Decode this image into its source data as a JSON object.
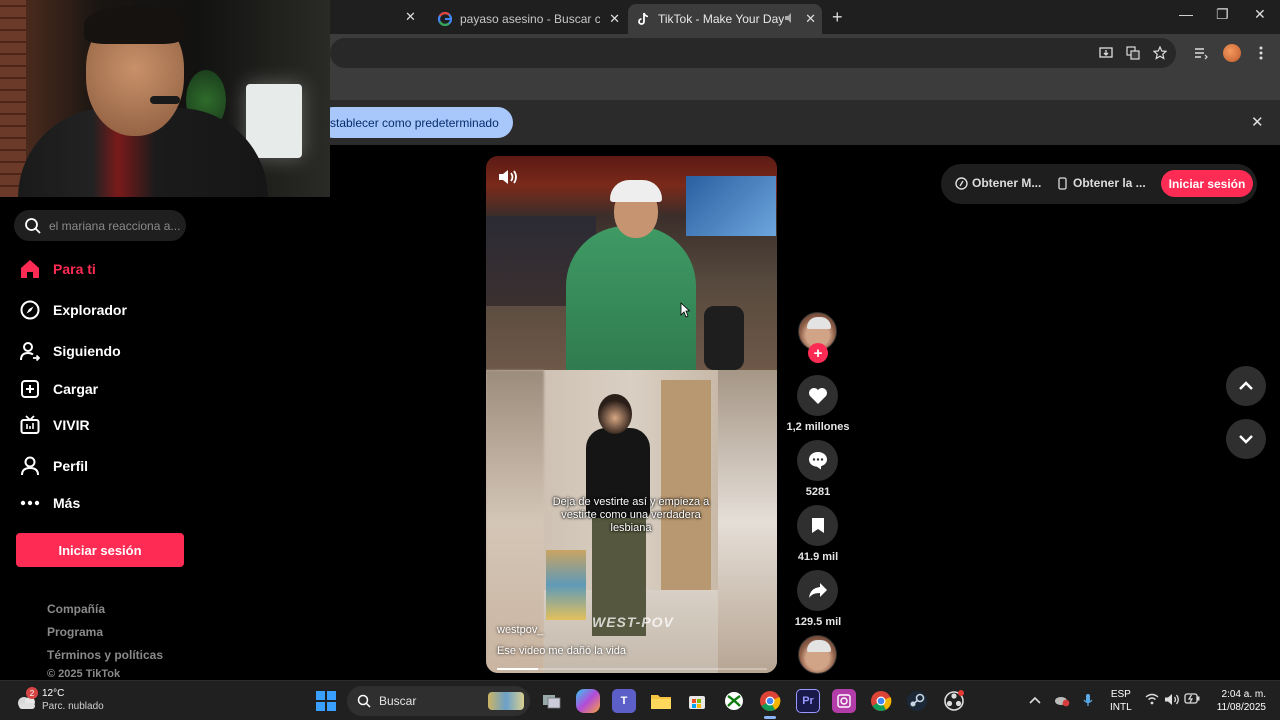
{
  "browser": {
    "tabs": [
      {
        "label": "payaso asesino - Buscar con Google",
        "favicon": "google-icon"
      },
      {
        "label": "TikTok - Make Your Day",
        "favicon": "tiktok-icon",
        "active": true
      }
    ],
    "new_tab_symbol": "+",
    "close_symbol": "✕",
    "window_controls": {
      "minimize": "—",
      "maximize": "❐",
      "close": "✕"
    }
  },
  "infobar": {
    "button_label": "stablecer como predeterminado",
    "close_symbol": "✕"
  },
  "sidebar": {
    "search_placeholder": "el mariana reacciona a...",
    "items": [
      {
        "label": "Para ti",
        "icon": "home-icon",
        "active": true
      },
      {
        "label": "Explorador",
        "icon": "compass-icon"
      },
      {
        "label": "Siguiendo",
        "icon": "following-icon"
      },
      {
        "label": "Cargar",
        "icon": "upload-icon"
      },
      {
        "label": "VIVIR",
        "icon": "live-icon"
      },
      {
        "label": "Perfil",
        "icon": "profile-icon"
      },
      {
        "label": "Más",
        "icon": "more-icon"
      }
    ],
    "login_label": "Iniciar sesión",
    "footer": [
      "Compañía",
      "Programa",
      "Términos y políticas"
    ],
    "copyright": "© 2025 TikTok"
  },
  "video": {
    "caption_overlay": "Deja de vestirte así y empieza a vestirte como una verdadera lesbiana",
    "watermark": "WEST-POV",
    "author": "westpov_",
    "description": "Ese video me dañó la vida",
    "progress": 0.15
  },
  "actions": {
    "likes": "1,2 millones",
    "comments": "5281",
    "saves": "41.9 mil",
    "shares": "129.5 mil",
    "follow_symbol": "+"
  },
  "top_right": {
    "get_coins": "Obtener M...",
    "get_app": "Obtener la ...",
    "login": "Iniciar sesión"
  },
  "taskbar": {
    "weather_temp": "12°C",
    "weather_desc": "Parc. nublado",
    "weather_badge": "2",
    "search_label": "Buscar",
    "language": "ESP",
    "keyboard": "INTL",
    "time": "2:04 a. m.",
    "date": "11/08/2025",
    "apps": [
      "file-explorer-icon",
      "copilot-icon",
      "teams-icon",
      "folder-icon",
      "store-icon",
      "xbox-icon",
      "chrome-icon",
      "premiere-icon",
      "photo-icon",
      "chrome-alt-icon",
      "steam-icon",
      "obs-icon"
    ]
  },
  "colors": {
    "tiktok_pink": "#fe2c55",
    "background": "#000000",
    "chrome_dark": "#1f1f1f"
  }
}
